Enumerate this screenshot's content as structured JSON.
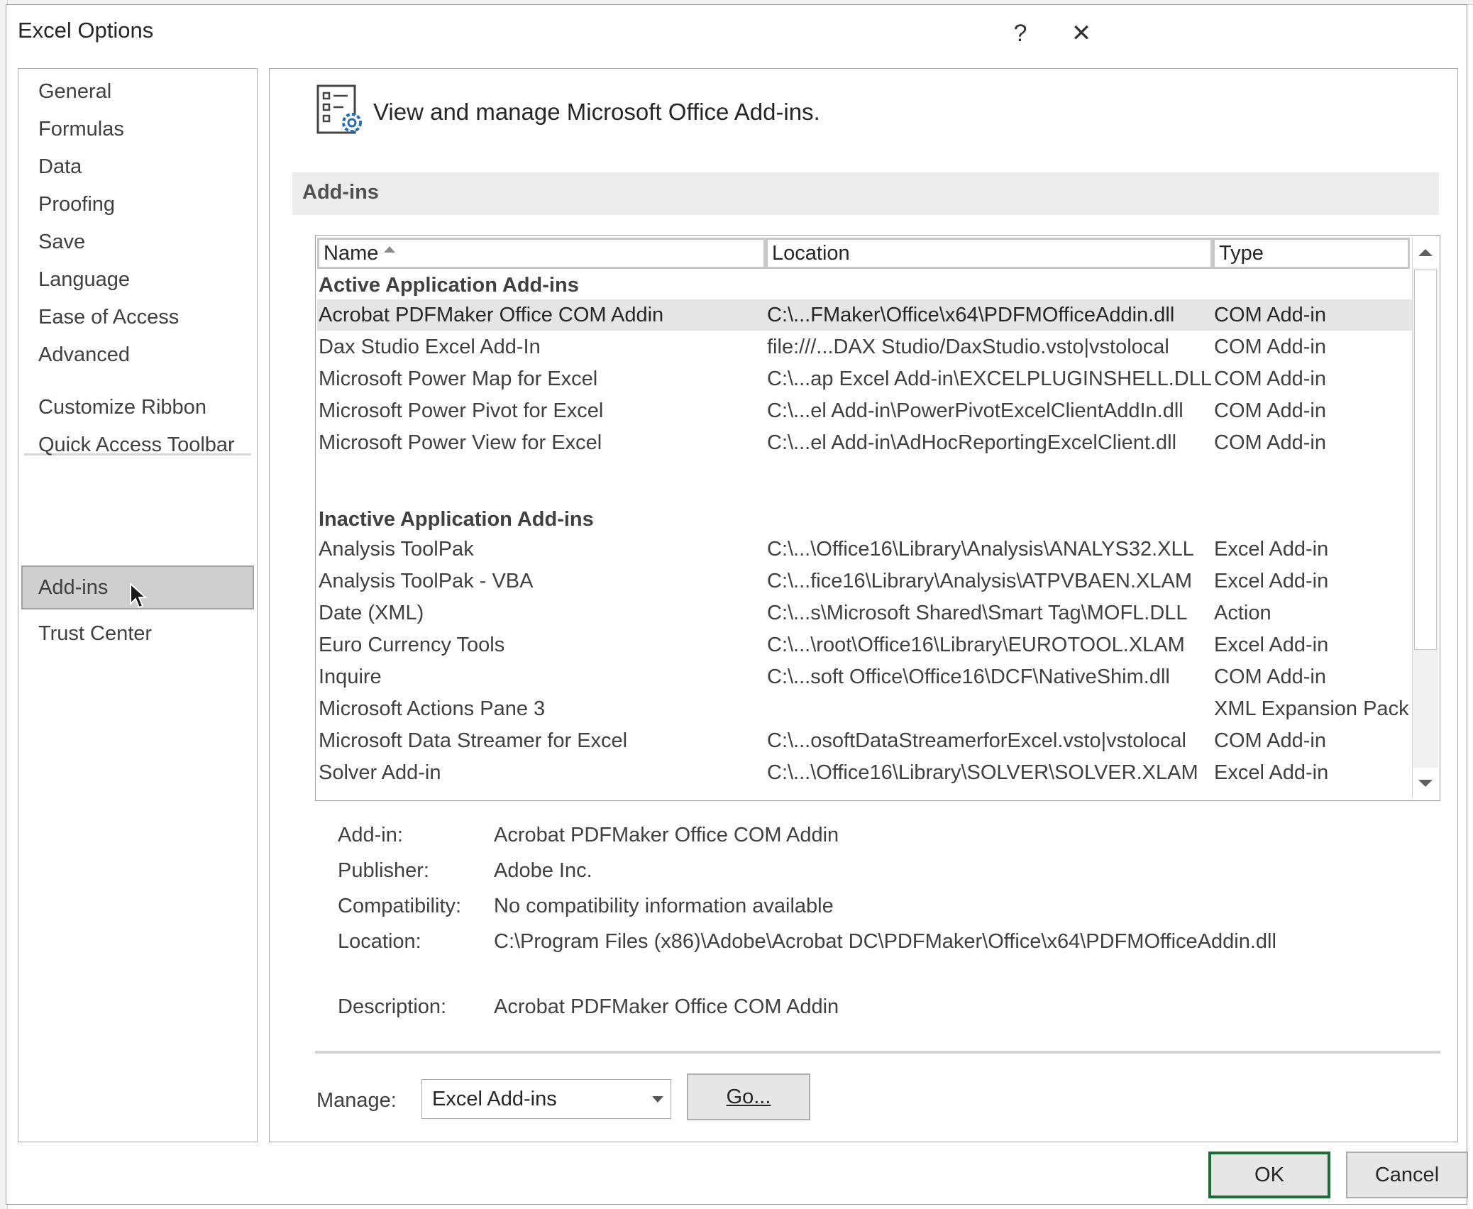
{
  "window": {
    "title": "Excel Options",
    "help_glyph": "?",
    "close_glyph": "✕"
  },
  "nav": {
    "items": [
      {
        "label": "General"
      },
      {
        "label": "Formulas"
      },
      {
        "label": "Data"
      },
      {
        "label": "Proofing"
      },
      {
        "label": "Save"
      },
      {
        "label": "Language"
      },
      {
        "label": "Ease of Access"
      },
      {
        "label": "Advanced"
      },
      {
        "label": "Customize Ribbon"
      },
      {
        "label": "Quick Access Toolbar"
      },
      {
        "label": "Add-ins",
        "selected": true
      },
      {
        "label": "Trust Center"
      }
    ]
  },
  "header": {
    "text": "View and manage Microsoft Office Add-ins.",
    "icon": "addins-settings-icon"
  },
  "section": {
    "title": "Add-ins"
  },
  "table": {
    "columns": [
      "Name",
      "Location",
      "Type"
    ],
    "sort_column": "Name",
    "groups": [
      {
        "title": "Active Application Add-ins",
        "rows": [
          {
            "name": "Acrobat PDFMaker Office COM Addin",
            "location": "C:\\...FMaker\\Office\\x64\\PDFMOfficeAddin.dll",
            "type": "COM Add-in",
            "selected": true
          },
          {
            "name": "Dax Studio Excel Add-In",
            "location": "file:///...DAX Studio/DaxStudio.vsto|vstolocal",
            "type": "COM Add-in"
          },
          {
            "name": "Microsoft Power Map for Excel",
            "location": "C:\\...ap Excel Add-in\\EXCELPLUGINSHELL.DLL",
            "type": "COM Add-in"
          },
          {
            "name": "Microsoft Power Pivot for Excel",
            "location": "C:\\...el Add-in\\PowerPivotExcelClientAddIn.dll",
            "type": "COM Add-in"
          },
          {
            "name": "Microsoft Power View for Excel",
            "location": "C:\\...el Add-in\\AdHocReportingExcelClient.dll",
            "type": "COM Add-in"
          }
        ]
      },
      {
        "title": "Inactive Application Add-ins",
        "rows": [
          {
            "name": "Analysis ToolPak",
            "location": "C:\\...\\Office16\\Library\\Analysis\\ANALYS32.XLL",
            "type": "Excel Add-in"
          },
          {
            "name": "Analysis ToolPak - VBA",
            "location": "C:\\...fice16\\Library\\Analysis\\ATPVBAEN.XLAM",
            "type": "Excel Add-in"
          },
          {
            "name": "Date (XML)",
            "location": "C:\\...s\\Microsoft Shared\\Smart Tag\\MOFL.DLL",
            "type": "Action"
          },
          {
            "name": "Euro Currency Tools",
            "location": "C:\\...\\root\\Office16\\Library\\EUROTOOL.XLAM",
            "type": "Excel Add-in"
          },
          {
            "name": "Inquire",
            "location": "C:\\...soft Office\\Office16\\DCF\\NativeShim.dll",
            "type": "COM Add-in"
          },
          {
            "name": "Microsoft Actions Pane 3",
            "location": "",
            "type": "XML Expansion Pack"
          },
          {
            "name": "Microsoft Data Streamer for Excel",
            "location": "C:\\...osoftDataStreamerforExcel.vsto|vstolocal",
            "type": "COM Add-in"
          },
          {
            "name": "Solver Add-in",
            "location": "C:\\...\\Office16\\Library\\SOLVER\\SOLVER.XLAM",
            "type": "Excel Add-in"
          }
        ]
      }
    ]
  },
  "details": [
    {
      "label": "Add-in:",
      "value": "Acrobat PDFMaker Office COM Addin"
    },
    {
      "label": "Publisher:",
      "value": "Adobe Inc."
    },
    {
      "label": "Compatibility:",
      "value": "No compatibility information available"
    },
    {
      "label": "Location:",
      "value": "C:\\Program Files (x86)\\Adobe\\Acrobat DC\\PDFMaker\\Office\\x64\\PDFMOfficeAddin.dll"
    },
    {
      "label": "Description:",
      "value": "Acrobat PDFMaker Office COM Addin"
    }
  ],
  "manage": {
    "label": "Manage:",
    "selected": "Excel Add-ins",
    "go_label": "Go..."
  },
  "footer": {
    "ok_label": "OK",
    "cancel_label": "Cancel"
  },
  "colors": {
    "ok_border": "#1e6b3a",
    "selected_nav": "#cfcfcf",
    "icon_blue": "#2b6cb0"
  }
}
